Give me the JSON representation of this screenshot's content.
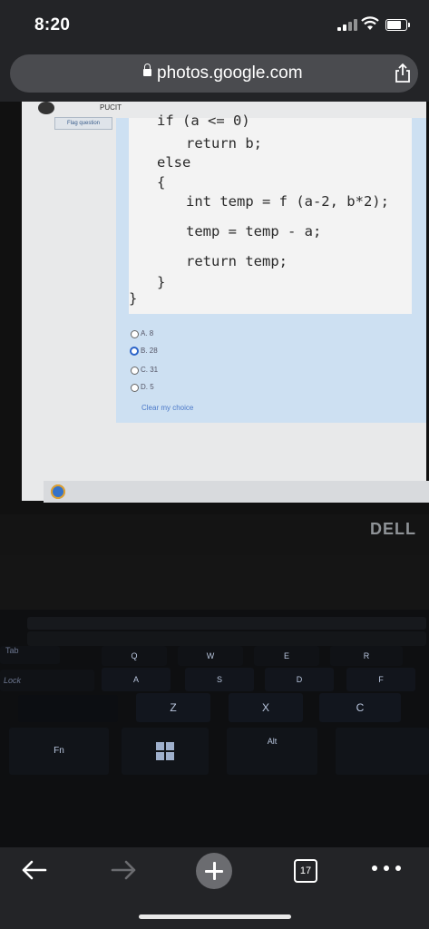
{
  "status": {
    "time": "8:20"
  },
  "browser": {
    "url": "photos.google.com"
  },
  "photo": {
    "header": {
      "org": "PUCIT",
      "flag_label": "Flag question"
    },
    "code_lines": [
      "if (a <= 0)",
      "return b;",
      "else",
      "{",
      "int temp = f (a-2, b*2);",
      "temp = temp - a;",
      "return temp;",
      "}",
      "}"
    ],
    "options": [
      {
        "label": "A. 8",
        "selected": false
      },
      {
        "label": "B. 28",
        "selected": true
      },
      {
        "label": "C. 31",
        "selected": false
      },
      {
        "label": "D. 5",
        "selected": false
      }
    ],
    "clear_label": "Clear my choice",
    "laptop_brand": "DELL",
    "keys": [
      "Q",
      "W",
      "E",
      "R",
      "A",
      "S",
      "D",
      "F",
      "Z",
      "X",
      "C",
      "Fn",
      "Alt",
      "Tab",
      "Lock"
    ]
  },
  "toolbar": {
    "tab_count": "17"
  },
  "colors": {
    "bar_bg": "#232427",
    "url_bg": "#4a4b4f",
    "panel": "#cde0f2",
    "selected_radio": "#2b63c8"
  },
  "icons": [
    "lock-icon",
    "share-icon",
    "back-arrow-icon",
    "forward-arrow-icon",
    "plus-icon",
    "tabs-icon",
    "more-icon",
    "signal-icon",
    "wifi-icon",
    "battery-icon"
  ]
}
